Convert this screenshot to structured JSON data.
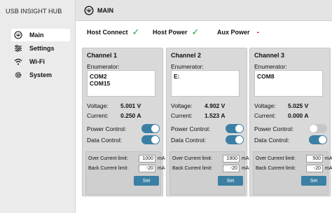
{
  "app": {
    "title": "USB INSIGHT HUB"
  },
  "nav": {
    "items": [
      {
        "label": "Main",
        "icon": "usb-icon",
        "active": true
      },
      {
        "label": "Settings",
        "icon": "sliders-icon",
        "active": false
      },
      {
        "label": "Wi-Fi",
        "icon": "wifi-icon",
        "active": false
      },
      {
        "label": "System",
        "icon": "gear-icon",
        "active": false
      }
    ]
  },
  "header": {
    "title": "MAIN",
    "icon": "usb-icon"
  },
  "status": {
    "host_connect": {
      "label": "Host Connect",
      "state": "ok",
      "symbol": "✓"
    },
    "host_power": {
      "label": "Host Power",
      "state": "ok",
      "symbol": "✓"
    },
    "aux_power": {
      "label": "Aux Power",
      "state": "off",
      "symbol": "-"
    }
  },
  "colors": {
    "accent": "#3b7fa4",
    "ok": "#2e9a3e",
    "error": "#d41e1e"
  },
  "channels": [
    {
      "title": "Channel 1",
      "enumerator_label": "Enumerator:",
      "enumerator_lines": [
        "COM2",
        "COM15"
      ],
      "voltage_label": "Voltage:",
      "voltage": "5.001 V",
      "current_label": "Current:",
      "current": "0.250 A",
      "power_label": "Power Control:",
      "power_on": true,
      "data_label": "Data Control:",
      "data_on": true,
      "over_label": "Over Current limit:",
      "over_value": "1000",
      "over_unit": "mA",
      "back_label": "Back Current limit:",
      "back_value": "-20",
      "back_unit": "mA",
      "set_label": "Set"
    },
    {
      "title": "Channel 2",
      "enumerator_label": "Enumerator:",
      "enumerator_lines": [
        "E:",
        ""
      ],
      "voltage_label": "Voltage:",
      "voltage": "4.902 V",
      "current_label": "Current:",
      "current": "1.523 A",
      "power_label": "Power Control:",
      "power_on": true,
      "data_label": "Data Control:",
      "data_on": true,
      "over_label": "Over Current limit:",
      "over_value": "1900",
      "over_unit": "mA",
      "back_label": "Back Current limit:",
      "back_value": "-20",
      "back_unit": "mA",
      "set_label": "Set"
    },
    {
      "title": "Channel 3",
      "enumerator_label": "Enumerator:",
      "enumerator_lines": [
        "COM8",
        ""
      ],
      "voltage_label": "Voltage:",
      "voltage": "5.025 V",
      "current_label": "Current:",
      "current": "0.000 A",
      "power_label": "Power Control:",
      "power_on": false,
      "data_label": "Data Control:",
      "data_on": true,
      "over_label": "Over Current limit:",
      "over_value": "500",
      "over_unit": "mA",
      "back_label": "Back Current limit:",
      "back_value": "-20",
      "back_unit": "mA",
      "set_label": "Set"
    }
  ]
}
